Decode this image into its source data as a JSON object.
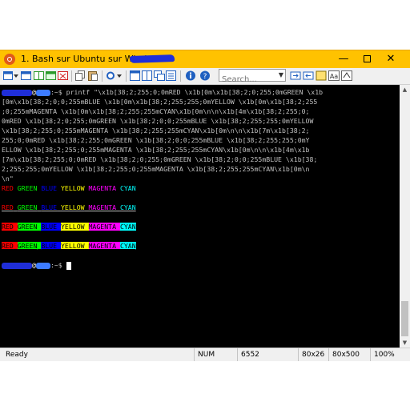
{
  "window": {
    "title": "1. Bash sur Ubuntu sur Windows -"
  },
  "toolbar": {
    "search_placeholder": "Search..."
  },
  "terminal": {
    "prompt_suffix": ":~$ ",
    "command_lines": [
      "printf \"\\x1b[38;2;255;0;0mRED \\x1b[0m\\x1b[38;2;0;255;0mGREEN \\x1b",
      "[0m\\x1b[38;2;0;0;255mBLUE \\x1b[0m\\x1b[38;2;255;255;0mYELLOW \\x1b[0m\\x1b[38;2;255",
      ";0;255mMAGENTA \\x1b[0m\\x1b[38;2;255;255mCYAN\\x1b[0m\\n\\n\\x1b[4m\\x1b[38;2;255;0;",
      "0mRED \\x1b[38;2;0;255;0mGREEN \\x1b[38;2;0;0;255mBLUE \\x1b[38;2;255;255;0mYELLOW",
      "\\x1b[38;2;255;0;255mMAGENTA \\x1b[38;2;255;255mCYAN\\x1b[0m\\n\\n\\x1b[7m\\x1b[38;2;",
      "255;0;0mRED \\x1b[38;2;255;0mGREEN \\x1b[38;2;0;0;255mBLUE \\x1b[38;2;255;255;0mY",
      "ELLOW \\x1b[38;2;255;0;255mMAGENTA \\x1b[38;2;255;255mCYAN\\x1b[0m\\n\\n\\x1b[4m\\x1b",
      "[7m\\x1b[38;2;255;0;0mRED \\x1b[38;2;0;255;0mGREEN \\x1b[38;2;0;0;255mBLUE \\x1b[38;",
      "2;255;255;0mYELLOW \\x1b[38;2;255;0;255mMAGENTA \\x1b[38;2;255;255mCYAN\\x1b[0m\\n",
      "\\n\""
    ],
    "color_words": [
      "RED",
      "GREEN",
      "BLUE",
      "YELLOW",
      "MAGENTA",
      "CYAN"
    ],
    "colors": {
      "red": "#ff0000",
      "green": "#00ff00",
      "blue": "#0000ff",
      "yellow": "#ffff00",
      "magenta": "#ff00ff",
      "cyan": "#00ffff"
    }
  },
  "statusbar": {
    "ready": "Ready",
    "num": "NUM",
    "buffer": "6552",
    "size1": "80x26",
    "size2": "80x500",
    "zoom": "100%"
  }
}
